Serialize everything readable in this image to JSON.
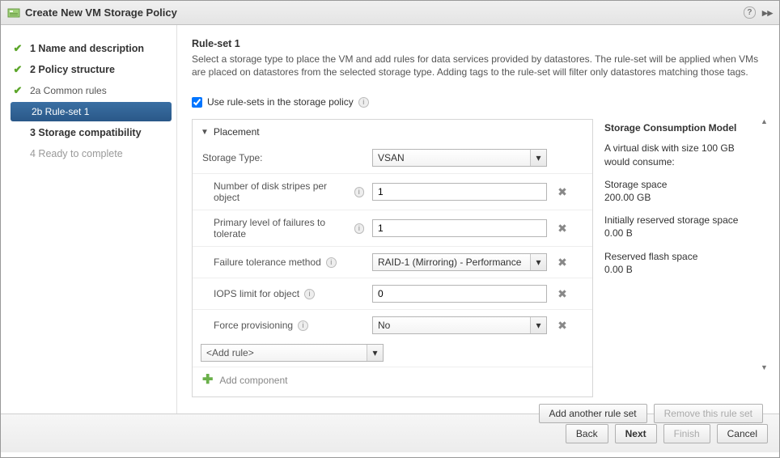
{
  "title": "Create New VM Storage Policy",
  "nav": {
    "step1": "1  Name and description",
    "step2": "2  Policy structure",
    "step2a": "2a  Common rules",
    "step2b": "2b  Rule-set 1",
    "step3": "3  Storage compatibility",
    "step4": "4  Ready to complete"
  },
  "content": {
    "heading": "Rule-set 1",
    "description": "Select a storage type to place the VM and add rules for data services provided by datastores. The rule-set will be applied when VMs are placed on datastores from the selected storage type. Adding tags to the rule-set will filter only datastores matching those tags.",
    "use_rule_sets_label": "Use rule-sets in the storage policy",
    "section": "Placement",
    "rows": {
      "storage_type_label": "Storage Type:",
      "storage_type_value": "VSAN",
      "stripes_label": "Number of disk stripes per object",
      "stripes_value": "1",
      "ftt_label": "Primary level of failures to tolerate",
      "ftt_value": "1",
      "ftm_label": "Failure tolerance method",
      "ftm_value": "RAID-1 (Mirroring) - Performance",
      "iops_label": "IOPS limit for object",
      "iops_value": "0",
      "force_label": "Force provisioning",
      "force_value": "No",
      "add_rule": "<Add rule>",
      "add_component": "Add component"
    },
    "rulebtns": {
      "add_another": "Add another rule set",
      "remove": "Remove this rule set"
    }
  },
  "consume": {
    "title": "Storage Consumption Model",
    "p1": "A virtual disk with size 100 GB would consume:",
    "p2a": "Storage space",
    "p2b": "200.00 GB",
    "p3a": "Initially reserved storage space",
    "p3b": "0.00 B",
    "p4a": "Reserved flash space",
    "p4b": "0.00 B"
  },
  "footer": {
    "back": "Back",
    "next": "Next",
    "finish": "Finish",
    "cancel": "Cancel"
  }
}
